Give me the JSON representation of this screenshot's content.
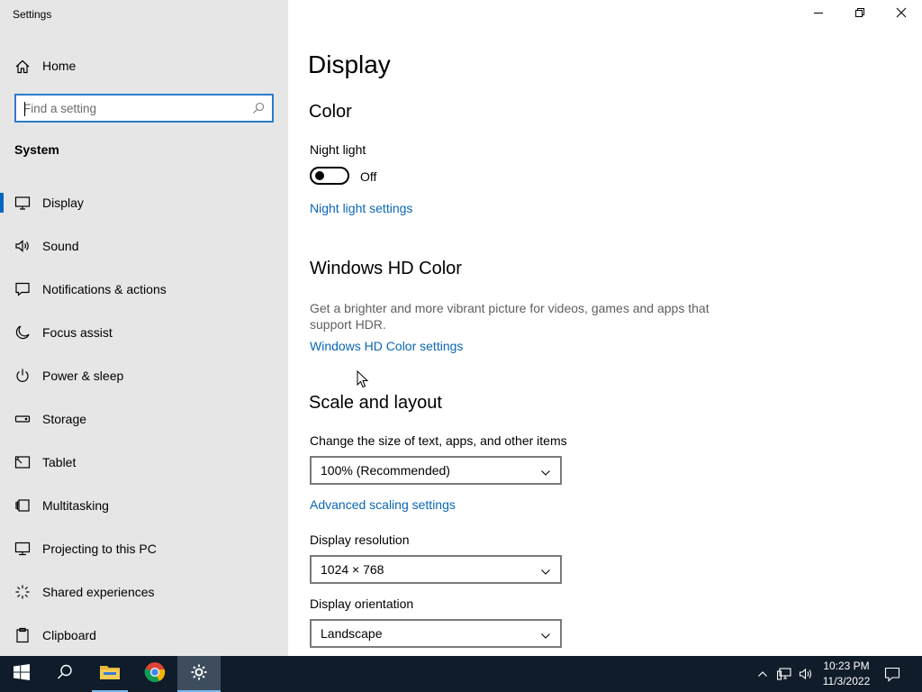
{
  "window": {
    "title": "Settings",
    "controls": {
      "minimize_icon": "minimize-icon",
      "maximize_icon": "restore-icon",
      "close_icon": "close-icon"
    }
  },
  "sidebar": {
    "home_label": "Home",
    "search": {
      "placeholder": "Find a setting",
      "value": ""
    },
    "section_title": "System",
    "items": [
      {
        "label": "Display",
        "icon": "monitor-icon",
        "selected": true
      },
      {
        "label": "Sound",
        "icon": "speaker-icon",
        "selected": false
      },
      {
        "label": "Notifications & actions",
        "icon": "notification-icon",
        "selected": false
      },
      {
        "label": "Focus assist",
        "icon": "moon-icon",
        "selected": false
      },
      {
        "label": "Power & sleep",
        "icon": "power-icon",
        "selected": false
      },
      {
        "label": "Storage",
        "icon": "storage-icon",
        "selected": false
      },
      {
        "label": "Tablet",
        "icon": "tablet-icon",
        "selected": false
      },
      {
        "label": "Multitasking",
        "icon": "multitasking-icon",
        "selected": false
      },
      {
        "label": "Projecting to this PC",
        "icon": "projecting-icon",
        "selected": false
      },
      {
        "label": "Shared experiences",
        "icon": "shared-icon",
        "selected": false
      },
      {
        "label": "Clipboard",
        "icon": "clipboard-icon",
        "selected": false
      }
    ]
  },
  "main": {
    "page_title": "Display",
    "color": {
      "heading": "Color",
      "night_light_label": "Night light",
      "night_light_state": "Off",
      "night_light_on": false,
      "night_light_link": "Night light settings"
    },
    "hd_color": {
      "heading": "Windows HD Color",
      "description": "Get a brighter and more vibrant picture for videos, games and apps that support HDR.",
      "link": "Windows HD Color settings"
    },
    "scale_layout": {
      "heading": "Scale and layout",
      "scale_label": "Change the size of text, apps, and other items",
      "scale_value": "100% (Recommended)",
      "advanced_link": "Advanced scaling settings",
      "resolution_label": "Display resolution",
      "resolution_value": "1024 × 768",
      "orientation_label": "Display orientation",
      "orientation_value": "Landscape"
    }
  },
  "taskbar": {
    "apps": [
      "start-icon",
      "search-icon",
      "file-explorer-icon",
      "chrome-icon",
      "settings-icon"
    ],
    "active_app": "settings-icon",
    "clock": {
      "time": "10:23 PM",
      "date": "11/3/2022"
    }
  },
  "colors": {
    "accent": "#0067c0",
    "link": "#0b66b5",
    "sidebar_bg": "#e6e6e6",
    "taskbar_bg": "#101c2a"
  }
}
